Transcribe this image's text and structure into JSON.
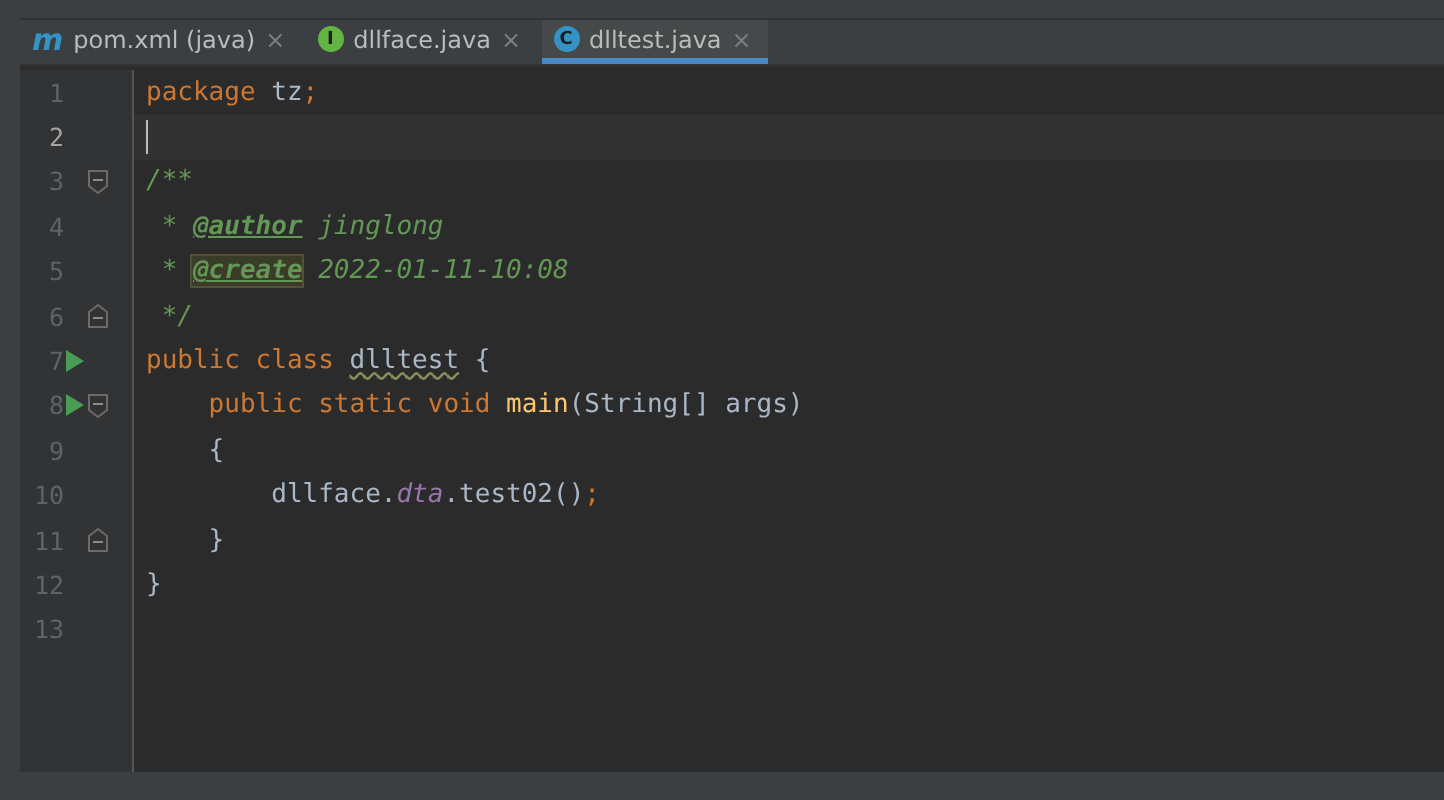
{
  "tabs": [
    {
      "label": "pom.xml (java)",
      "kind": "maven",
      "icon_letter": "m",
      "close": "×",
      "selected": false
    },
    {
      "label": "dllface.java",
      "kind": "interface",
      "icon_letter": "I",
      "close": "×",
      "selected": false
    },
    {
      "label": "dlltest.java",
      "kind": "class",
      "icon_letter": "C",
      "close": "×",
      "selected": true
    }
  ],
  "editor": {
    "lines": [
      {
        "number": "1",
        "current": false,
        "runnable": false,
        "fold_start": false,
        "fold_end": false,
        "tokens": [
          {
            "kind": "keyword",
            "text": "package "
          },
          {
            "kind": "plain",
            "text": "tz"
          },
          {
            "kind": "punct",
            "text": ";"
          }
        ]
      },
      {
        "number": "2",
        "current": true,
        "runnable": false,
        "fold_start": false,
        "fold_end": false
      },
      {
        "number": "3",
        "current": false,
        "runnable": false,
        "fold_start": true,
        "fold_end": false,
        "tokens": [
          {
            "kind": "comment",
            "text": "/**"
          }
        ]
      },
      {
        "number": "4",
        "current": false,
        "runnable": false,
        "fold_start": false,
        "fold_end": false,
        "tokens": [
          {
            "kind": "comment",
            "text": " * "
          },
          {
            "kind": "doctag",
            "text": "@author"
          },
          {
            "kind": "comment",
            "text": " jinglong"
          }
        ]
      },
      {
        "number": "5",
        "current": false,
        "runnable": false,
        "fold_start": false,
        "fold_end": false,
        "tokens": [
          {
            "kind": "comment",
            "text": " * "
          },
          {
            "kind": "doctag-marked",
            "text": "@create"
          },
          {
            "kind": "comment",
            "text": " 2022-01-11-10:08"
          }
        ]
      },
      {
        "number": "6",
        "current": false,
        "runnable": false,
        "fold_start": false,
        "fold_end": true,
        "tokens": [
          {
            "kind": "comment",
            "text": " */"
          }
        ]
      },
      {
        "number": "7",
        "current": false,
        "runnable": true,
        "fold_start": false,
        "fold_end": false,
        "tokens": [
          {
            "kind": "keyword",
            "text": "public class "
          },
          {
            "kind": "warning",
            "text": "dlltest"
          },
          {
            "kind": "plain",
            "text": " {"
          }
        ]
      },
      {
        "number": "8",
        "current": false,
        "runnable": true,
        "fold_start": true,
        "fold_end": false,
        "tokens": [
          {
            "kind": "keyword",
            "text": "    public static void "
          },
          {
            "kind": "method",
            "text": "main"
          },
          {
            "kind": "plain",
            "text": "(String[] args)"
          }
        ]
      },
      {
        "number": "9",
        "current": false,
        "runnable": false,
        "fold_start": false,
        "fold_end": false,
        "tokens": [
          {
            "kind": "plain",
            "text": "    {"
          }
        ]
      },
      {
        "number": "10",
        "current": false,
        "runnable": false,
        "fold_start": false,
        "fold_end": false,
        "tokens": [
          {
            "kind": "plain",
            "text": "        dllface."
          },
          {
            "kind": "field",
            "text": "dta"
          },
          {
            "kind": "plain",
            "text": ".test02()"
          },
          {
            "kind": "punct",
            "text": ";"
          }
        ]
      },
      {
        "number": "11",
        "current": false,
        "runnable": false,
        "fold_start": false,
        "fold_end": true,
        "tokens": [
          {
            "kind": "plain",
            "text": "    }"
          }
        ]
      },
      {
        "number": "12",
        "current": false,
        "runnable": false,
        "fold_start": false,
        "fold_end": false,
        "tokens": [
          {
            "kind": "plain",
            "text": "}"
          }
        ]
      },
      {
        "number": "13",
        "current": false,
        "runnable": false,
        "fold_start": false,
        "fold_end": false
      }
    ]
  }
}
